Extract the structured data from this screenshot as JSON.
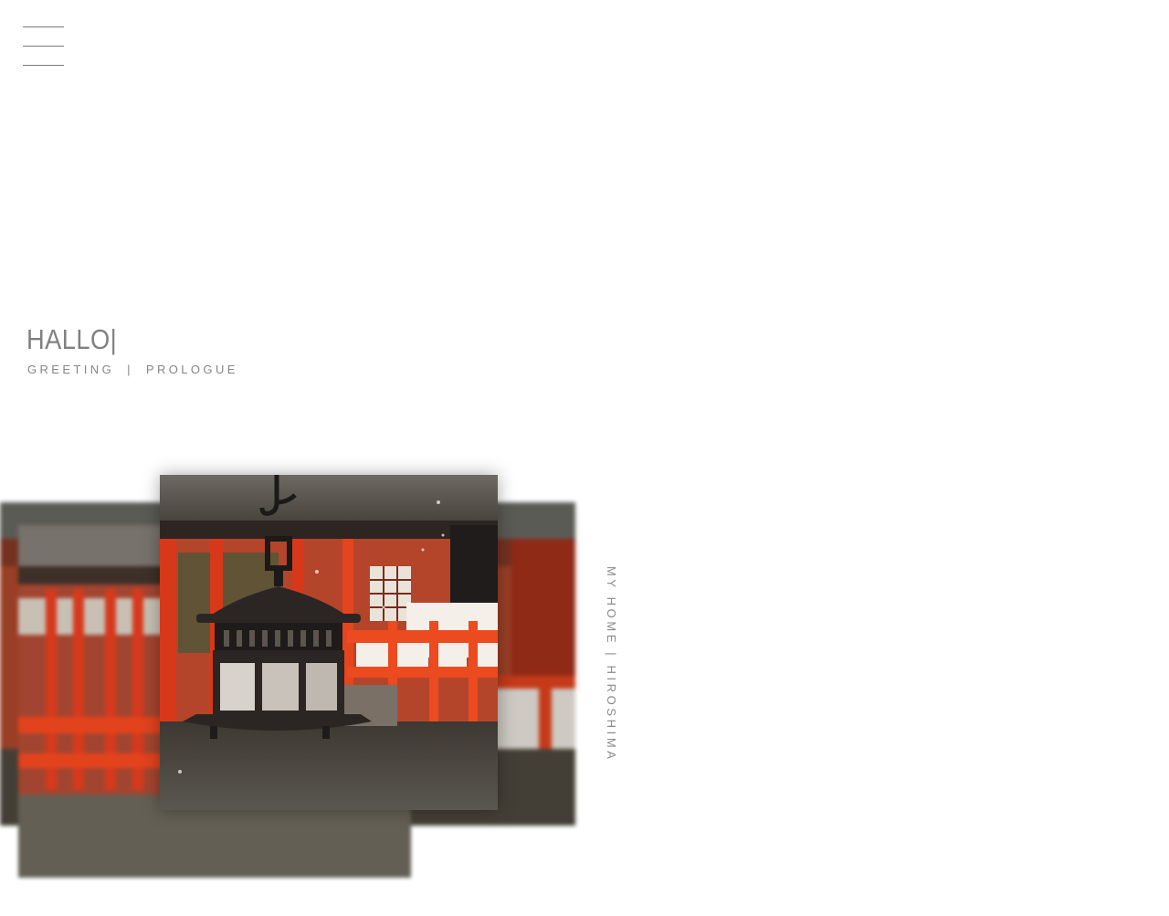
{
  "hero": {
    "title": "HALLO|",
    "subtitle": "GREETING  |  PROLOGUE"
  },
  "caption": {
    "vertical": "MY HOME | HIROSHIMA"
  },
  "menu": {
    "icon": "hamburger-menu-icon"
  },
  "photos": {
    "front_subject": "hanging iron lantern",
    "background_subject": "red shrine corridor with white panels"
  },
  "colors": {
    "text_gray": "#808080",
    "shrine_red": "#d23a1e",
    "panel_white": "#f4efe8",
    "lantern_black": "#2b2624"
  }
}
